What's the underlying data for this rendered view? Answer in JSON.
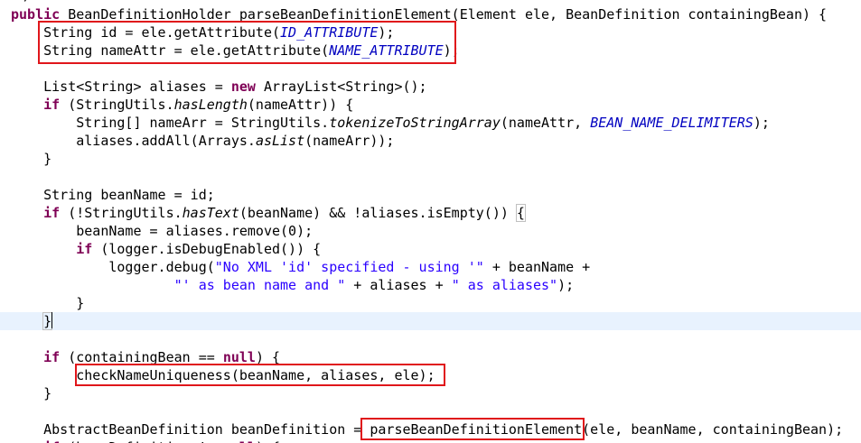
{
  "editor": {
    "language": "Java",
    "colors": {
      "keyword": "#7f0055",
      "string": "#2a00ff",
      "constant": "#0000c0",
      "current_line": "#e8f2fe",
      "annotation_box": "#e0161b"
    },
    "lines": [
      [
        {
          "t": "public",
          "s": "kw"
        },
        {
          "t": " BeanDefinitionHolder parseBeanDefinitionElement(Element ele, BeanDefinition containingBean) {",
          "s": "plain"
        }
      ],
      [
        {
          "t": "    String id = ele.getAttribute(",
          "s": "plain"
        },
        {
          "t": "ID_ATTRIBUTE",
          "s": "const"
        },
        {
          "t": ");",
          "s": "plain"
        }
      ],
      [
        {
          "t": "    String nameAttr = ele.getAttribute(",
          "s": "plain"
        },
        {
          "t": "NAME_ATTRIBUTE",
          "s": "const"
        },
        {
          "t": ");",
          "s": "plain"
        }
      ],
      [],
      [
        {
          "t": "    List<String> aliases = ",
          "s": "plain"
        },
        {
          "t": "new",
          "s": "kw"
        },
        {
          "t": " ArrayList<String>();",
          "s": "plain"
        }
      ],
      [
        {
          "t": "    ",
          "s": "plain"
        },
        {
          "t": "if",
          "s": "kw"
        },
        {
          "t": " (StringUtils.",
          "s": "plain"
        },
        {
          "t": "hasLength",
          "s": "static-call"
        },
        {
          "t": "(nameAttr)) {",
          "s": "plain"
        }
      ],
      [
        {
          "t": "        String[] nameArr = StringUtils.",
          "s": "plain"
        },
        {
          "t": "tokenizeToStringArray",
          "s": "static-call"
        },
        {
          "t": "(nameAttr, ",
          "s": "plain"
        },
        {
          "t": "BEAN_NAME_DELIMITERS",
          "s": "const"
        },
        {
          "t": ");",
          "s": "plain"
        }
      ],
      [
        {
          "t": "        aliases.addAll(Arrays.",
          "s": "plain"
        },
        {
          "t": "asList",
          "s": "static-call"
        },
        {
          "t": "(nameArr));",
          "s": "plain"
        }
      ],
      [
        {
          "t": "    }",
          "s": "plain"
        }
      ],
      [],
      [
        {
          "t": "    String beanName = id;",
          "s": "plain"
        }
      ],
      [
        {
          "t": "    ",
          "s": "plain"
        },
        {
          "t": "if",
          "s": "kw"
        },
        {
          "t": " (!StringUtils.",
          "s": "plain"
        },
        {
          "t": "hasText",
          "s": "static-call"
        },
        {
          "t": "(beanName) && !aliases.isEmpty()) ",
          "s": "plain"
        },
        {
          "t": "{",
          "s": "bracket-box"
        }
      ],
      [
        {
          "t": "        beanName = aliases.remove(0);",
          "s": "plain"
        }
      ],
      [
        {
          "t": "        ",
          "s": "plain"
        },
        {
          "t": "if",
          "s": "kw"
        },
        {
          "t": " (logger.isDebugEnabled()) {",
          "s": "plain"
        }
      ],
      [
        {
          "t": "            logger.debug(",
          "s": "plain"
        },
        {
          "t": "\"No XML 'id' specified - using '\"",
          "s": "str"
        },
        {
          "t": " + beanName +",
          "s": "plain"
        }
      ],
      [
        {
          "t": "                    ",
          "s": "plain"
        },
        {
          "t": "\"' as bean name and \"",
          "s": "str"
        },
        {
          "t": " + aliases + ",
          "s": "plain"
        },
        {
          "t": "\" as aliases\"",
          "s": "str"
        },
        {
          "t": ");",
          "s": "plain"
        }
      ],
      [
        {
          "t": "        }",
          "s": "plain"
        }
      ],
      [
        {
          "t": "    ",
          "s": "plain"
        },
        {
          "t": "}",
          "s": "bracket-box"
        }
      ],
      [],
      [
        {
          "t": "    ",
          "s": "plain"
        },
        {
          "t": "if",
          "s": "kw"
        },
        {
          "t": " (containingBean == ",
          "s": "plain"
        },
        {
          "t": "null",
          "s": "kw"
        },
        {
          "t": ") {",
          "s": "plain"
        }
      ],
      [
        {
          "t": "        checkNameUniqueness(beanName, aliases, ele);",
          "s": "plain"
        }
      ],
      [
        {
          "t": "    }",
          "s": "plain"
        }
      ],
      [],
      [
        {
          "t": "    AbstractBeanDefinition beanDefinition = parseBeanDefinitionElement(ele, beanName, containingBean);",
          "s": "plain"
        }
      ],
      [
        {
          "t": "    ",
          "s": "plain"
        },
        {
          "t": "if",
          "s": "kw"
        },
        {
          "t": " (beanDefinition != ",
          "s": "plain"
        },
        {
          "t": "null",
          "s": "kw"
        },
        {
          "t": ") {",
          "s": "plain"
        }
      ]
    ],
    "current_line_index": 17
  }
}
